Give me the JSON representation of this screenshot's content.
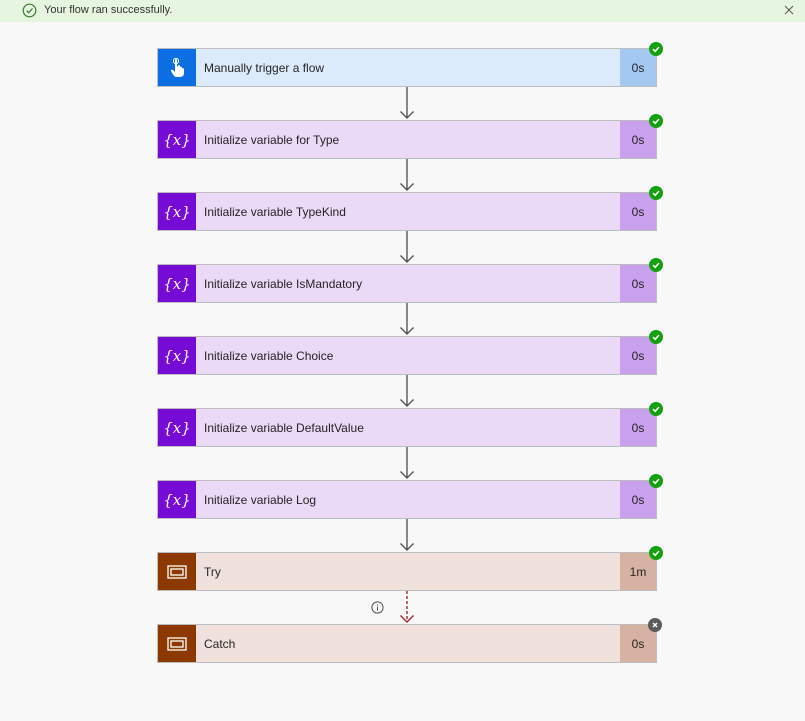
{
  "banner": {
    "message": "Your flow ran successfully.",
    "status_icon": "check-circle-icon",
    "close_icon": "close-icon"
  },
  "steps": [
    {
      "label": "Manually trigger a flow",
      "duration": "0s",
      "kind": "trigger",
      "status": "succeeded",
      "icon": "touch-hand-icon"
    },
    {
      "label": "Initialize variable for Type",
      "duration": "0s",
      "kind": "variable",
      "status": "succeeded",
      "icon": "variable-icon"
    },
    {
      "label": "Initialize variable TypeKind",
      "duration": "0s",
      "kind": "variable",
      "status": "succeeded",
      "icon": "variable-icon"
    },
    {
      "label": "Initialize variable IsMandatory",
      "duration": "0s",
      "kind": "variable",
      "status": "succeeded",
      "icon": "variable-icon"
    },
    {
      "label": "Initialize variable Choice",
      "duration": "0s",
      "kind": "variable",
      "status": "succeeded",
      "icon": "variable-icon"
    },
    {
      "label": "Initialize variable DefaultValue",
      "duration": "0s",
      "kind": "variable",
      "status": "succeeded",
      "icon": "variable-icon"
    },
    {
      "label": "Initialize variable Log",
      "duration": "0s",
      "kind": "variable",
      "status": "succeeded",
      "icon": "variable-icon"
    },
    {
      "label": "Try",
      "duration": "1m",
      "kind": "scope",
      "status": "succeeded",
      "icon": "scope-icon"
    },
    {
      "label": "Catch",
      "duration": "0s",
      "kind": "scope",
      "status": "skipped",
      "icon": "scope-icon"
    }
  ],
  "colors": {
    "trigger_accent": "#0b6fe3",
    "variable_accent": "#770bd6",
    "scope_accent": "#8c3900",
    "success": "#13a10e",
    "banner_bg": "#e5f5df",
    "run_after_failed_arrow": "#a4262c"
  }
}
